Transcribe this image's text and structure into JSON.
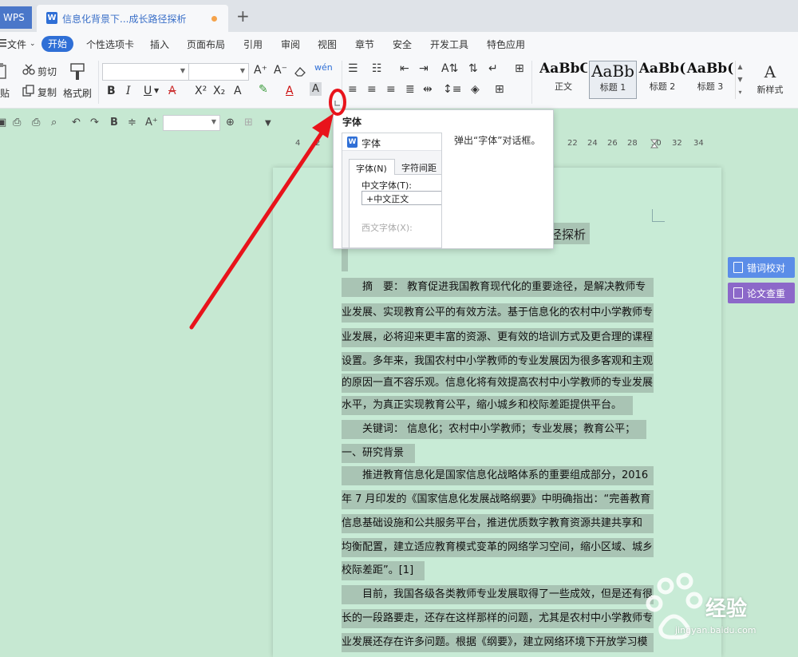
{
  "tabs": {
    "app": "WPS",
    "doc_title": "信息化背景下...成长路径探析",
    "new_tab": "+"
  },
  "menu": {
    "file": "文件",
    "items": [
      "开始",
      "个性选项卡",
      "插入",
      "页面布局",
      "引用",
      "审阅",
      "视图",
      "章节",
      "安全",
      "开发工具",
      "特色应用"
    ]
  },
  "ribbon": {
    "paste": "贴",
    "cut": "剪切",
    "copy": "复制",
    "format_painter": "格式刷",
    "styles": [
      {
        "sample": "AaBbC",
        "name": "正文"
      },
      {
        "sample": "AaBb",
        "name": "标题 1"
      },
      {
        "sample": "AaBb(",
        "name": "标题 2"
      },
      {
        "sample": "AaBb(",
        "name": "标题 3"
      }
    ],
    "new_style_sample": "A",
    "new_style": "新样式"
  },
  "ruler": {
    "ticks": [
      "4",
      "2",
      "22",
      "24",
      "26",
      "28",
      "30",
      "32",
      "34"
    ]
  },
  "document": {
    "title_fragment": "径探析",
    "lines": [
      "　　摘　要：  教育促进我国教育现代化的重要途径，是解决教师专",
      "业发展、实现教育公平的有效方法。基于信息化的农村中小学教师专",
      "业发展，必将迎来更丰富的资源、更有效的培训方式及更合理的课程",
      "设置。多年来，我国农村中小学教师的专业发展因为很多客观和主观",
      "的原因一直不容乐观。信息化将有效提高农村中小学教师的专业发展",
      "水平，为真正实现教育公平，缩小城乡和校际差距提供平台。",
      "　　关键词：  信息化；农村中小学教师；专业发展；教育公平；",
      "一、研究背景",
      "　　推进教育信息化是国家信息化战略体系的重要组成部分，2016",
      "年 7 月印发的《国家信息化发展战略纲要》中明确指出：“完善教育",
      "信息基础设施和公共服务平台，推进优质数字教育资源共建共享和",
      "均衡配置，建立适应教育模式变革的网络学习空间，缩小区域、城乡、",
      "校际差距”。[1]",
      "　　目前，我国各级各类教师专业发展取得了一些成效，但是还有很",
      "长的一段路要走，还存在这样那样的问题，尤其是农村中小学教师专",
      "业发展还存在许多问题。根据《纲要》，建立网络环境下开放学习模"
    ]
  },
  "side_buttons": {
    "proofread": "错词校对",
    "plagiarism": "论文查重"
  },
  "tooltip": {
    "title": "字体",
    "description": "弹出“字体”对话框。",
    "dialog_title": "字体",
    "tab_font": "字体(N)",
    "tab_spacing": "字符间距",
    "chinese_font_label": "中文字体(T):",
    "chinese_font_value": "+中文正文",
    "western_font_label": "西文字体(X):"
  },
  "watermark": {
    "brand": "经验",
    "url": "jingyan.baidu.com"
  },
  "colors": {
    "accent": "#2f6fd6",
    "doc_bg": "#c6e8d2",
    "highlight": "#a9c4b4",
    "annotation": "#e8131b",
    "proofread_btn": "#5b8de8",
    "plagiarism_btn": "#8c68c9"
  }
}
